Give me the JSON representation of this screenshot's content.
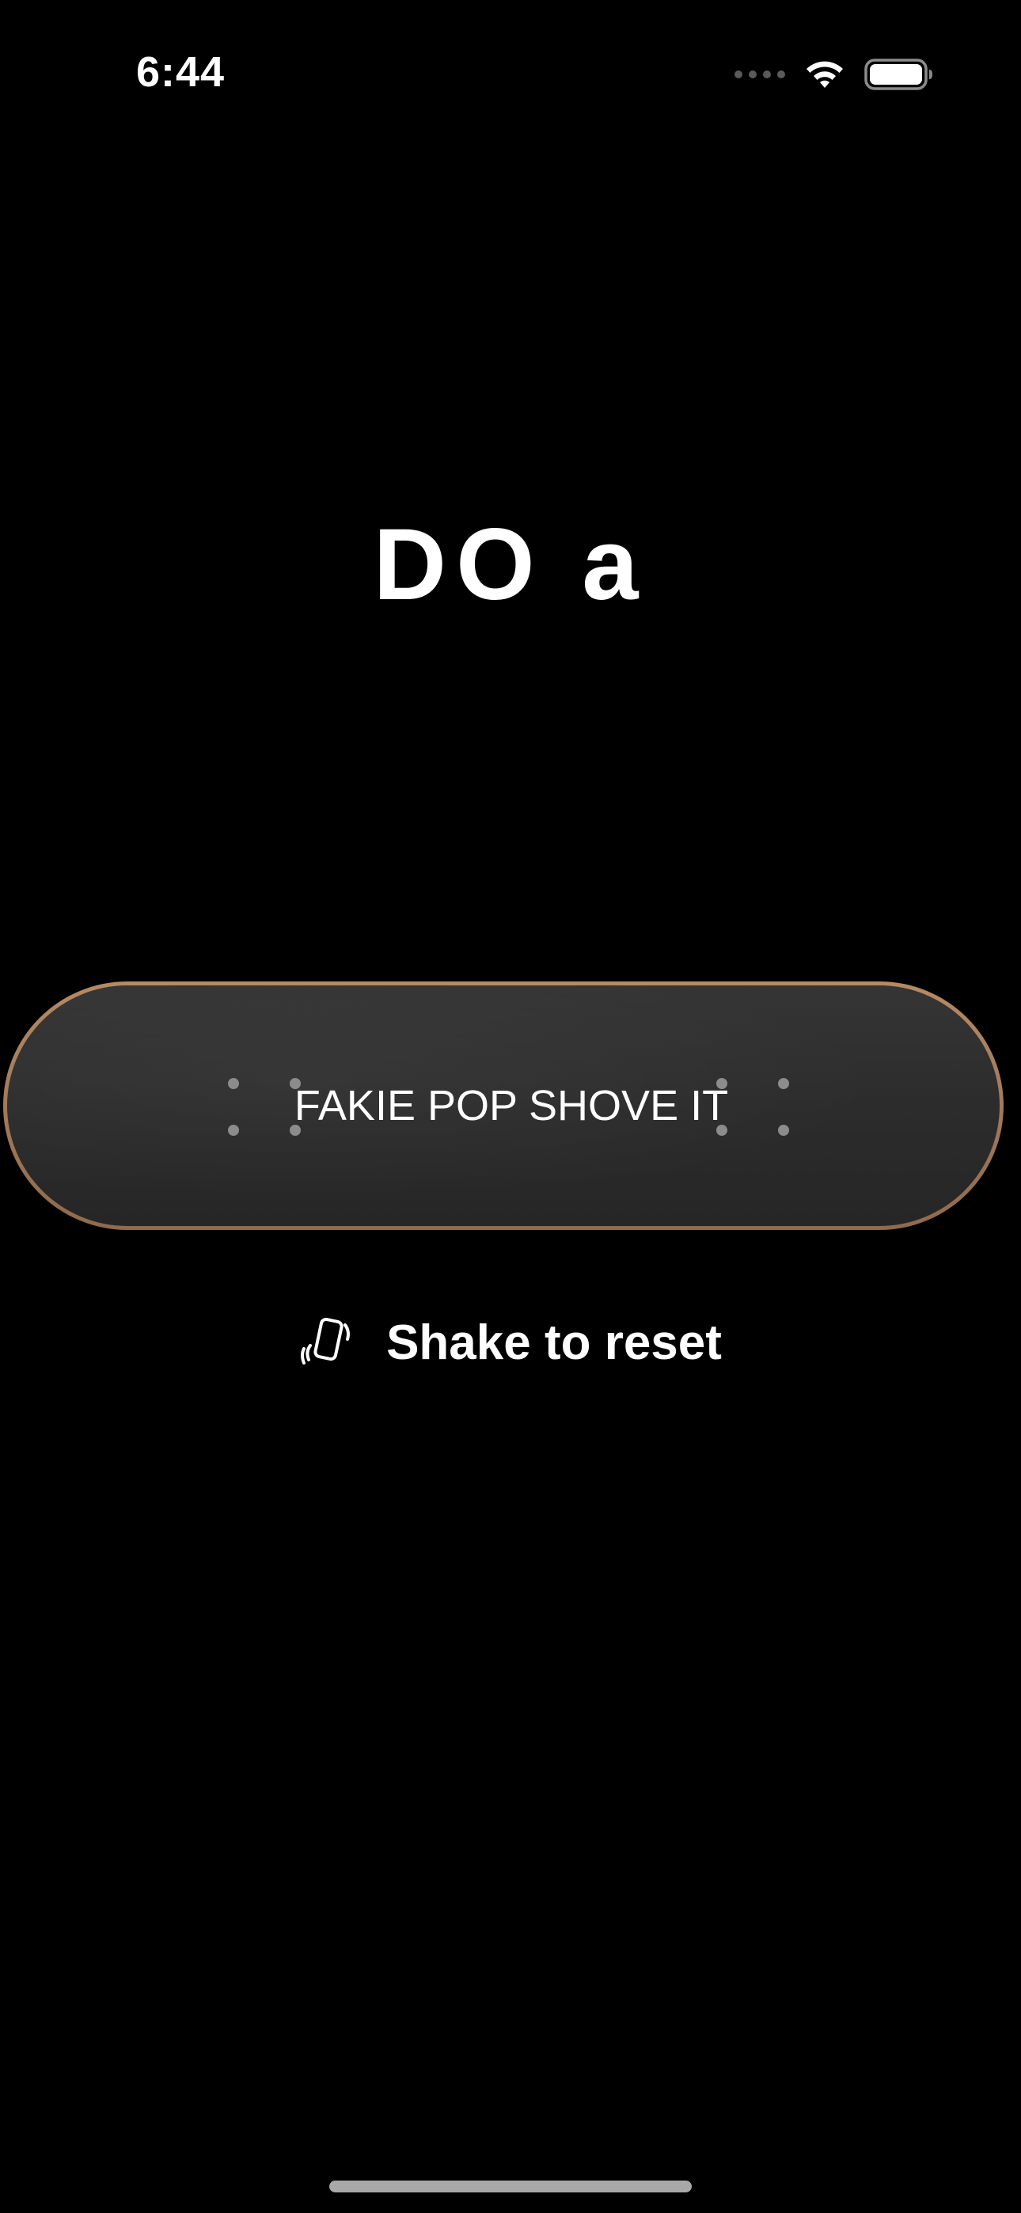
{
  "status_bar": {
    "time": "6:44",
    "wifi_icon": "wifi-icon",
    "battery_icon": "battery-icon",
    "battery_level": 1.0
  },
  "main": {
    "prompt": "DO a",
    "trick": "FAKIE POP SHOVE IT",
    "shake_hint": "Shake to reset",
    "shake_icon": "phone-shake-icon"
  },
  "colors": {
    "background": "#000000",
    "text": "#ffffff",
    "deck": "#2e2e2e",
    "deck_edge": "#a77d59"
  }
}
